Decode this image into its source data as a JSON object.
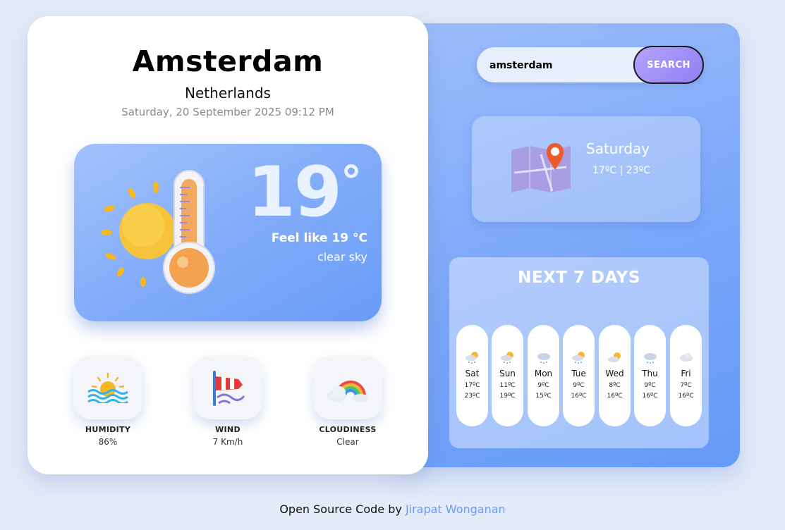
{
  "location": {
    "city": "Amsterdam",
    "country": "Netherlands",
    "datetime": "Saturday, 20 September 2025 09:12 PM"
  },
  "current": {
    "temperature": "19",
    "degree_symbol": "°",
    "feels_like": "Feel like 19 °C",
    "description": "clear sky"
  },
  "stats": [
    {
      "title": "HUMIDITY",
      "value": "86%",
      "icon": "sun-over-water-icon"
    },
    {
      "title": "WIND",
      "value": "7 Km/h",
      "icon": "windsock-icon"
    },
    {
      "title": "CLOUDINESS",
      "value": "Clear",
      "icon": "rainbow-cloud-icon"
    }
  ],
  "search": {
    "value": "amsterdam",
    "button_label": "SEARCH"
  },
  "today": {
    "day": "Saturday",
    "range": "17ºC | 23ºC",
    "icon": "map-pin-icon"
  },
  "forecast": {
    "title": "NEXT 7 DAYS",
    "days": [
      {
        "day": "Sat",
        "low": "17ºC",
        "high": "23ºC",
        "icon": "sun-cloud-rain-icon"
      },
      {
        "day": "Sun",
        "low": "11ºC",
        "high": "19ºC",
        "icon": "sun-cloud-rain-icon"
      },
      {
        "day": "Mon",
        "low": "9ºC",
        "high": "15ºC",
        "icon": "cloud-rain-icon"
      },
      {
        "day": "Tue",
        "low": "9ºC",
        "high": "16ºC",
        "icon": "sun-cloud-rain-icon"
      },
      {
        "day": "Wed",
        "low": "8ºC",
        "high": "16ºC",
        "icon": "sun-cloud-icon"
      },
      {
        "day": "Thu",
        "low": "9ºC",
        "high": "16ºC",
        "icon": "cloud-rain-icon"
      },
      {
        "day": "Fri",
        "low": "7ºC",
        "high": "16ºC",
        "icon": "cloud-icon"
      }
    ]
  },
  "footer": {
    "text": "Open Source Code by",
    "author": "Jirapat Wonganan"
  },
  "colors": {
    "panel_blue": "#7aa6f9",
    "button_purple": "#8f7ff4",
    "link_blue": "#6f9cf2"
  }
}
